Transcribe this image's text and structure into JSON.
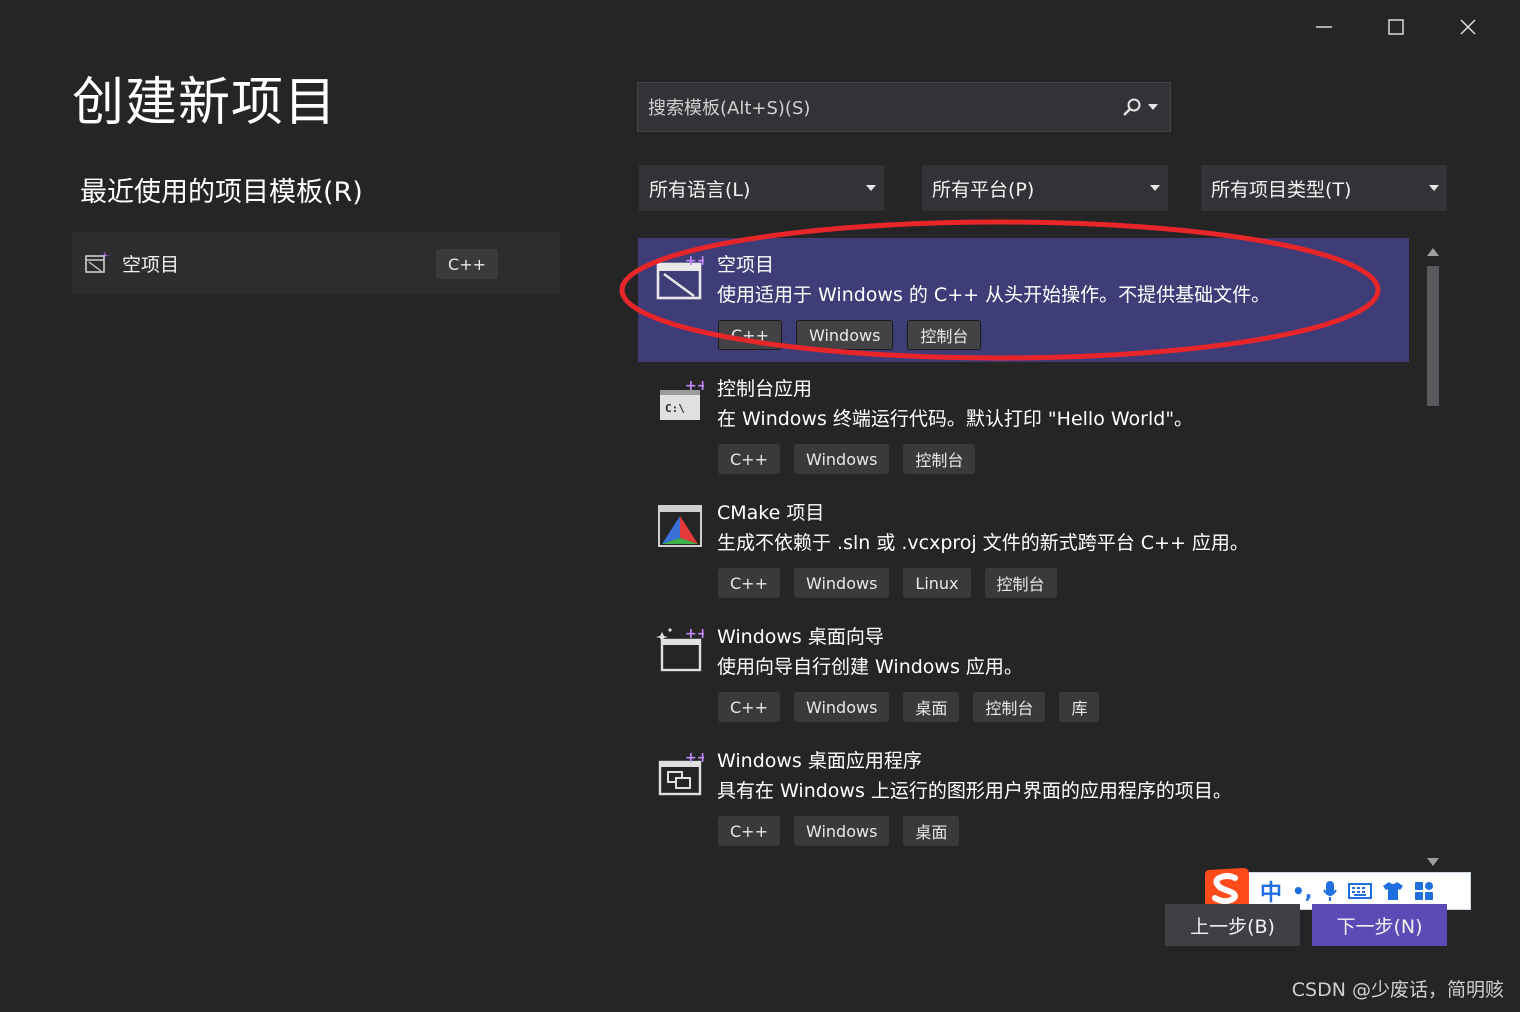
{
  "window": {
    "minimize_label": "minimize",
    "maximize_label": "maximize",
    "close_label": "close"
  },
  "page": {
    "title": "创建新项目",
    "recent_section_title": "最近使用的项目模板(R)"
  },
  "recent_templates": [
    {
      "name": "空项目",
      "tag": "C++",
      "icon": "empty-project-icon"
    }
  ],
  "search": {
    "placeholder": "搜索模板(Alt+S)(S)",
    "value": ""
  },
  "filters": {
    "language": "所有语言(L)",
    "platform": "所有平台(P)",
    "project_type": "所有项目类型(T)"
  },
  "templates": [
    {
      "name": "空项目",
      "description": "使用适用于 Windows 的 C++ 从头开始操作。不提供基础文件。",
      "tags": [
        "C++",
        "Windows",
        "控制台"
      ],
      "selected": true,
      "icon": "empty-project-icon"
    },
    {
      "name": "控制台应用",
      "description": "在 Windows 终端运行代码。默认打印 \"Hello World\"。",
      "tags": [
        "C++",
        "Windows",
        "控制台"
      ],
      "selected": false,
      "icon": "console-app-icon"
    },
    {
      "name": "CMake 项目",
      "description": "生成不依赖于 .sln 或 .vcxproj 文件的新式跨平台 C++ 应用。",
      "tags": [
        "C++",
        "Windows",
        "Linux",
        "控制台"
      ],
      "selected": false,
      "icon": "cmake-icon"
    },
    {
      "name": "Windows 桌面向导",
      "description": "使用向导自行创建 Windows 应用。",
      "tags": [
        "C++",
        "Windows",
        "桌面",
        "控制台",
        "库"
      ],
      "selected": false,
      "icon": "wizard-icon"
    },
    {
      "name": "Windows 桌面应用程序",
      "description": "具有在 Windows 上运行的图形用户界面的应用程序的项目。",
      "tags": [
        "C++",
        "Windows",
        "桌面"
      ],
      "selected": false,
      "icon": "desktop-app-icon"
    }
  ],
  "ime": {
    "mode": "中",
    "punct": "•,"
  },
  "buttons": {
    "back": "上一步(B)",
    "next": "下一步(N)"
  },
  "watermark": "CSDN @少废话，简明赅",
  "colors": {
    "background": "#252526",
    "selected_row": "#3f3d78",
    "accent_button": "#5b4bb7",
    "annotation_ellipse": "#e8262a",
    "ime_blue": "#1f6fe0",
    "ime_logo": "#ff4a1c"
  }
}
